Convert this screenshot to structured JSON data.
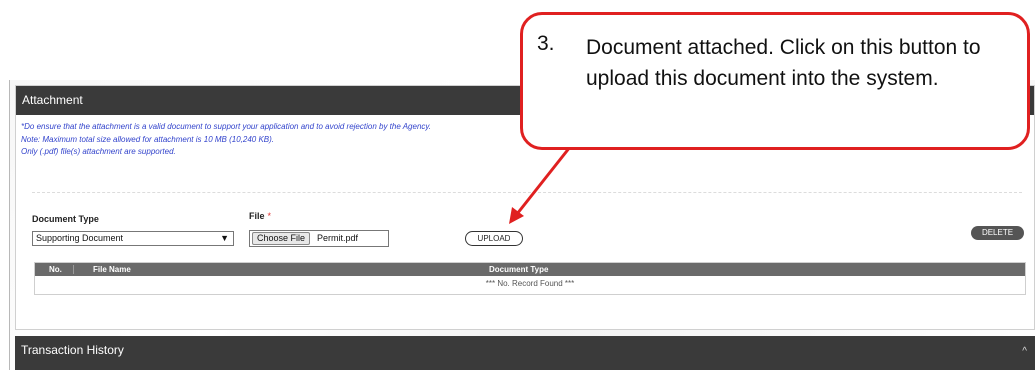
{
  "attachment": {
    "title": "Attachment",
    "notes": [
      "*Do ensure that the attachment is a valid document to support your application and to avoid rejection by the Agency.",
      "Note: Maximum total size allowed for attachment is 10 MB (10,240 KB).",
      "Only (.pdf) file(s) attachment are supported."
    ],
    "document_type_label": "Document Type",
    "document_type_value": "Supporting Document",
    "file_label": "File",
    "required_mark": "*",
    "choose_file_label": "Choose File",
    "file_name": "Permit.pdf",
    "upload_label": "UPLOAD",
    "delete_label": "DELETE",
    "table": {
      "columns": [
        "No.",
        "File Name",
        "Document Type"
      ],
      "empty_text": "*** No. Record Found ***"
    }
  },
  "transaction_history": {
    "title": "Transaction History",
    "caret": "^"
  },
  "callout": {
    "number": "3.",
    "text": "Document attached. Click on this button to upload this document into the system.",
    "color": "#e02020"
  },
  "colors": {
    "header_bg": "#3a3a3a",
    "note_text": "#3344cc",
    "table_header_bg": "#6a6a6a",
    "required": "#e03030"
  }
}
